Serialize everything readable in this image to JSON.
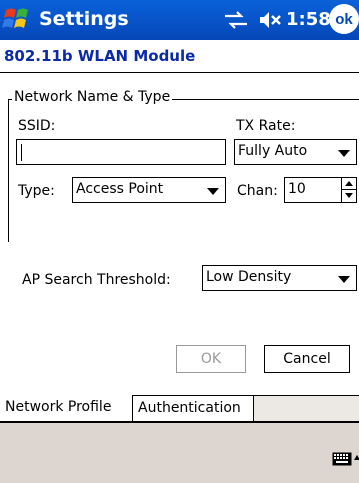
{
  "titlebar": {
    "app_title": "Settings",
    "clock": "1:58",
    "ok_label": "ok",
    "icons": [
      "start-flag-icon",
      "connectivity-icon",
      "volume-muted-icon"
    ],
    "color": "#0547b9"
  },
  "page": {
    "heading": "802.11b WLAN Module",
    "heading_color": "#0a2aa8"
  },
  "group": {
    "label": "Network Name & Type"
  },
  "fields": {
    "ssid_label": "SSID:",
    "ssid_value": "",
    "tx_rate_label": "TX Rate:",
    "tx_rate_value": "Fully Auto",
    "type_label": "Type:",
    "type_value": "Access Point",
    "chan_label": "Chan:",
    "chan_value": "10",
    "ap_search_label": "AP Search Threshold:",
    "ap_search_value": "Low Density"
  },
  "buttons": {
    "ok": "OK",
    "cancel": "Cancel"
  },
  "tabs": [
    {
      "label": "Network Profile",
      "active": true
    },
    {
      "label": "Authentication",
      "active": false
    }
  ],
  "bottombar": {
    "icons": [
      "keyboard-icon",
      "input-menu-arrow-icon"
    ],
    "color": "#ddd5cf"
  }
}
